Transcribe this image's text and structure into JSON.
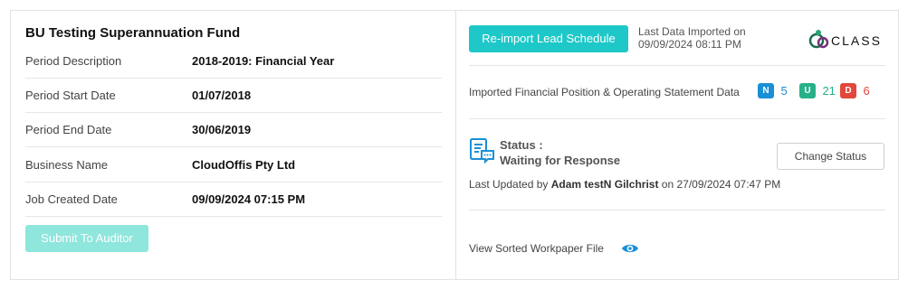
{
  "fund": {
    "title": "BU Testing Superannuation Fund",
    "details": [
      {
        "label": "Period Description",
        "value": "2018-2019: Financial Year"
      },
      {
        "label": "Period Start Date",
        "value": "01/07/2018"
      },
      {
        "label": "Period End Date",
        "value": "30/06/2019"
      },
      {
        "label": "Business Name",
        "value": "CloudOffis Pty Ltd"
      },
      {
        "label": "Job Created Date",
        "value": "09/09/2024 07:15 PM"
      }
    ],
    "submit_label": "Submit To Auditor"
  },
  "import": {
    "reimport_label": "Re-import Lead Schedule",
    "last_import_label": "Last Data Imported on",
    "last_import_value": "09/09/2024 08:11 PM",
    "logo_text": "CLASS",
    "data_label": "Imported Financial Position & Operating Statement Data",
    "counts": [
      {
        "badge": "N",
        "value": "5",
        "color": "#1a8fd6"
      },
      {
        "badge": "U",
        "value": "21",
        "color": "#27b08a"
      },
      {
        "badge": "D",
        "value": "6",
        "color": "#e2473b"
      }
    ]
  },
  "status": {
    "label": "Status :",
    "value": "Waiting for Response",
    "change_label": "Change Status",
    "updated_prefix": "Last Updated by",
    "updated_by": "Adam testN Gilchrist",
    "updated_suffix": "on 27/09/2024 07:47 PM"
  },
  "workpaper": {
    "label": "View Sorted Workpaper File"
  },
  "colors": {
    "accent": "#1ec8c8",
    "submit_disabled": "#8ee6dc",
    "icon_blue": "#1a8fd6"
  },
  "icons": [
    "class-logo-icon",
    "status-document-chat-icon",
    "eye-icon"
  ]
}
